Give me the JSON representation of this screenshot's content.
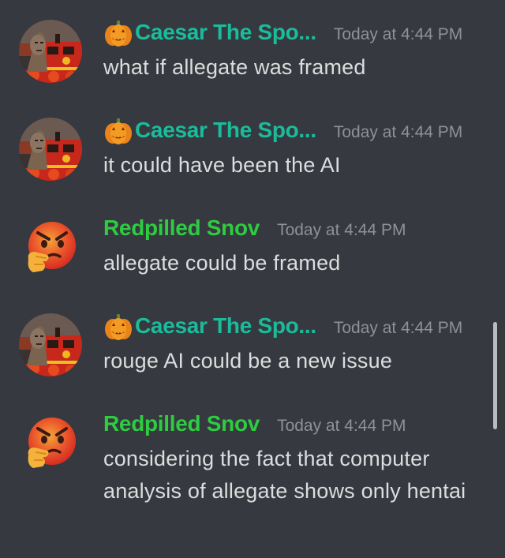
{
  "colors": {
    "background": "#36393f",
    "caesar_name": "#1abc9c",
    "snov_name": "#2ecc40",
    "timestamp": "#8e9297",
    "message_text": "#dcddde"
  },
  "messages": [
    {
      "username": "Caesar The Spo...",
      "has_pumpkin": true,
      "avatar_icon": "train-avatar-icon",
      "timestamp": "Today at 4:44 PM",
      "text": "what if allegate was framed"
    },
    {
      "username": "Caesar The Spo...",
      "has_pumpkin": true,
      "avatar_icon": "train-avatar-icon",
      "timestamp": "Today at 4:44 PM",
      "text": "it could have been the AI"
    },
    {
      "username": "Redpilled Snov",
      "has_pumpkin": false,
      "avatar_icon": "angry-thinking-face-icon",
      "timestamp": "Today at 4:44 PM",
      "text": "allegate could be framed"
    },
    {
      "username": "Caesar The Spo...",
      "has_pumpkin": true,
      "avatar_icon": "train-avatar-icon",
      "timestamp": "Today at 4:44 PM",
      "text": "rouge AI could be a new issue"
    },
    {
      "username": "Redpilled Snov",
      "has_pumpkin": false,
      "avatar_icon": "angry-thinking-face-icon",
      "timestamp": "Today at 4:44 PM",
      "text": "considering the fact that computer analysis of allegate shows only hentai"
    }
  ]
}
